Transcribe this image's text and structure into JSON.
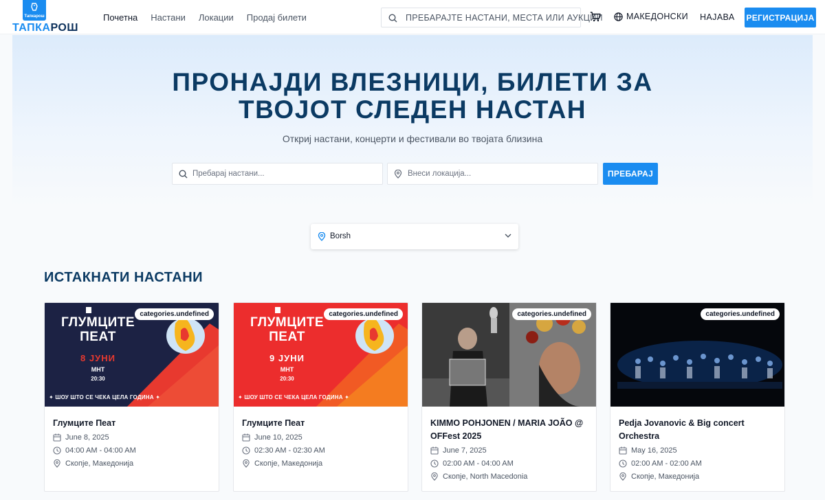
{
  "header": {
    "logo_small": "Тапкарош",
    "logo_part1": "ТАПКА",
    "logo_part2": "РОШ",
    "nav": [
      "Почетна",
      "Настани",
      "Локации",
      "Продај билети"
    ],
    "search_placeholder": "ПРЕБАРАЈТЕ НАСТАНИ, МЕСТА ИЛИ АУКЦИИ",
    "language": "МАКЕДОНСКИ",
    "login": "НАЈАВА",
    "register": "РЕГИСТРАЦИЈА"
  },
  "hero": {
    "title_line1": "ПРОНАЈДИ ВЛЕЗНИЦИ, БИЛЕТИ ЗА",
    "title_line2": "ТВОЈОТ СЛЕДЕН НАСТАН",
    "subtitle": "Откриј настани, концерти и фестивали во твојата близина",
    "search_placeholder": "Пребарај настани...",
    "location_placeholder": "Внеси локација...",
    "search_button": "ПРЕБАРАЈ"
  },
  "location_select": {
    "value": "Borsh"
  },
  "featured": {
    "title": "ИСТАКНАТИ НАСТАНИ",
    "cards": [
      {
        "badge": "categories.undefined",
        "title": "Глумците Пеат",
        "date": "June 8, 2025",
        "time": "04:00 AM - 04:00 AM",
        "location": "Скопје, Македонија",
        "poster": {
          "title1": "ГЛУМЦИТЕ",
          "title2": "ПЕАТ",
          "date": "8 ЈУНИ",
          "venue": "МНТ",
          "time": "20:30",
          "tag": "✦ ШОУ ШТО СЕ ЧЕКА ЦЕЛА ГОДИНА ✦"
        }
      },
      {
        "badge": "categories.undefined",
        "title": "Глумците Пеат",
        "date": "June 10, 2025",
        "time": "02:30 AM - 02:30 AM",
        "location": "Скопје, Македонија",
        "poster": {
          "title1": "ГЛУМЦИТЕ",
          "title2": "ПЕАТ",
          "date": "9 ЈУНИ",
          "venue": "МНТ",
          "time": "20:30",
          "tag": "✦ ШОУ ШТО СЕ ЧЕКА ЦЕЛА ГОДИНА ✦"
        }
      },
      {
        "badge": "categories.undefined",
        "title": "KIMMO POHJONEN / MARIA JOÃO @ OFFest 2025",
        "date": "June 7, 2025",
        "time": "02:00 AM - 04:00 AM",
        "location": "Скопје, North Macedonia"
      },
      {
        "badge": "categories.undefined",
        "title": "Pedja Jovanovic & Big concert Orchestra",
        "date": "May 16, 2025",
        "time": "02:00 AM - 02:00 AM",
        "location": "Скопје, Македонија"
      }
    ]
  },
  "colors": {
    "primary": "#1a8cf0",
    "heading": "#0b3a63",
    "poster_navy": "#1c2244",
    "poster_red": "#ec2d2d"
  }
}
